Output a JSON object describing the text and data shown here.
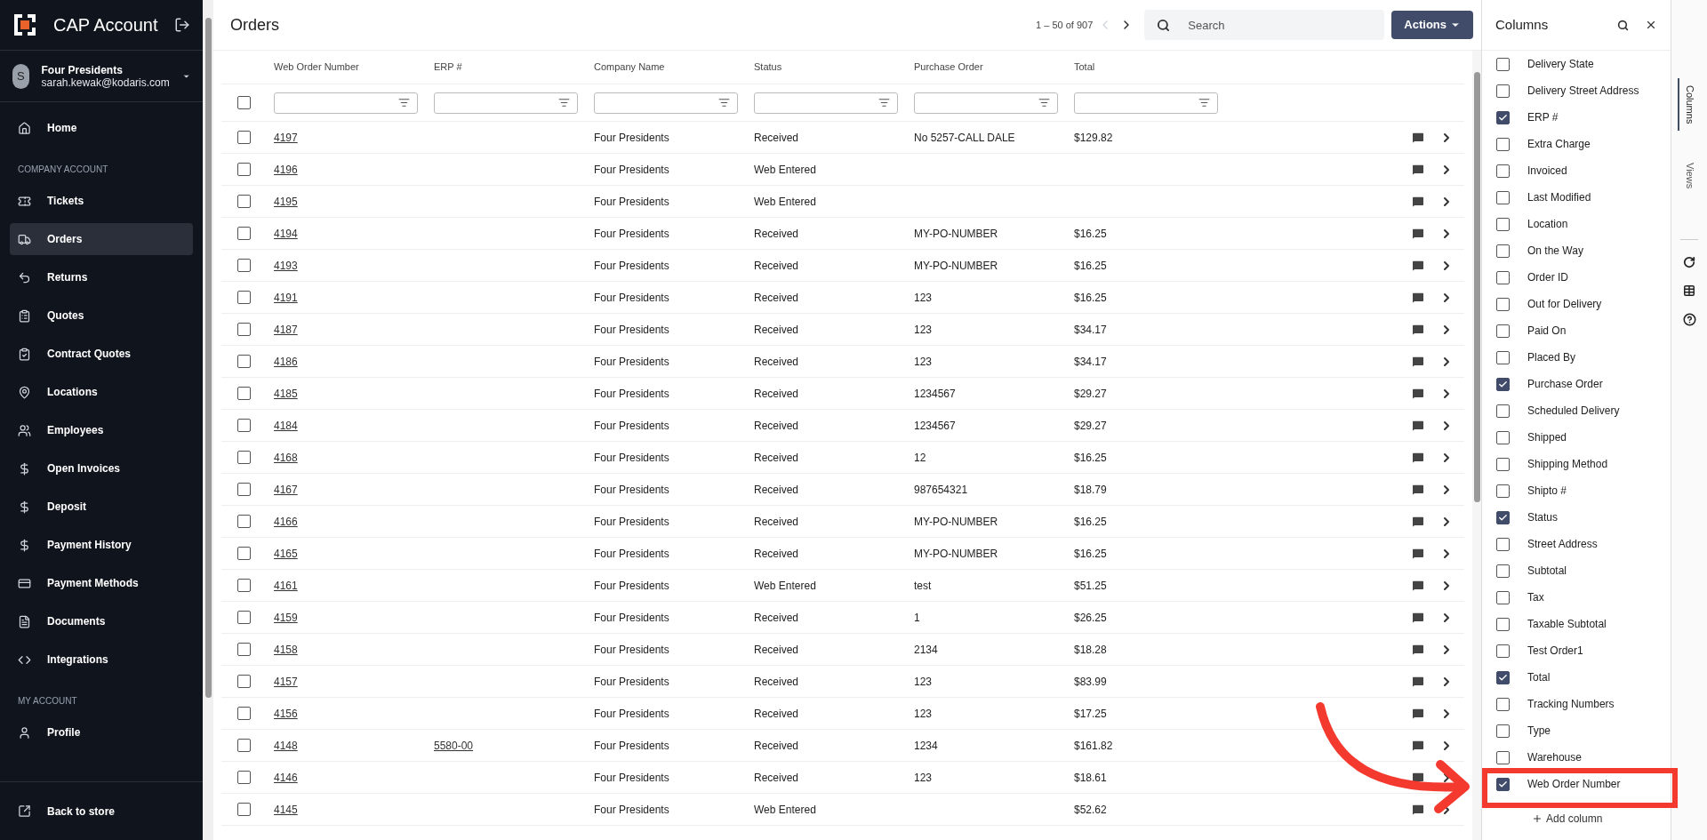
{
  "sidebar": {
    "app_title": "CAP Account",
    "user": {
      "initial": "S",
      "name": "Four Presidents",
      "email": "sarah.kewak@kodaris.com"
    },
    "sections": [
      {
        "items": [
          {
            "label": "Home",
            "selected": false
          }
        ]
      },
      {
        "heading": "COMPANY ACCOUNT",
        "items": [
          {
            "label": "Tickets",
            "selected": false
          },
          {
            "label": "Orders",
            "selected": true
          },
          {
            "label": "Returns",
            "selected": false
          },
          {
            "label": "Quotes",
            "selected": false
          },
          {
            "label": "Contract Quotes",
            "selected": false
          },
          {
            "label": "Locations",
            "selected": false
          },
          {
            "label": "Employees",
            "selected": false
          },
          {
            "label": "Open Invoices",
            "selected": false
          },
          {
            "label": "Deposit",
            "selected": false
          },
          {
            "label": "Payment History",
            "selected": false
          },
          {
            "label": "Payment Methods",
            "selected": false
          },
          {
            "label": "Documents",
            "selected": false
          },
          {
            "label": "Integrations",
            "selected": false
          }
        ]
      },
      {
        "heading": "MY ACCOUNT",
        "items": [
          {
            "label": "Profile",
            "selected": false
          }
        ]
      }
    ],
    "footer_item": "Back to store"
  },
  "header": {
    "title": "Orders",
    "pagination": "1 – 50 of 907",
    "search": {
      "placeholder": "Search"
    },
    "actions": "Actions"
  },
  "table": {
    "select_all_checked": false,
    "columns": [
      "Web Order Number",
      "ERP #",
      "Company Name",
      "Status",
      "Purchase Order",
      "Total"
    ],
    "rows": [
      {
        "checked": false,
        "cells": [
          "4197",
          "",
          "Four Presidents",
          "Received",
          "No 5257-CALL DALE",
          "$129.82"
        ]
      },
      {
        "checked": false,
        "cells": [
          "4196",
          "",
          "Four Presidents",
          "Web Entered",
          "",
          ""
        ]
      },
      {
        "checked": false,
        "cells": [
          "4195",
          "",
          "Four Presidents",
          "Web Entered",
          "",
          ""
        ]
      },
      {
        "checked": false,
        "cells": [
          "4194",
          "",
          "Four Presidents",
          "Received",
          "MY-PO-NUMBER",
          "$16.25"
        ]
      },
      {
        "checked": false,
        "cells": [
          "4193",
          "",
          "Four Presidents",
          "Received",
          "MY-PO-NUMBER",
          "$16.25"
        ]
      },
      {
        "checked": false,
        "cells": [
          "4191",
          "",
          "Four Presidents",
          "Received",
          "123",
          "$16.25"
        ]
      },
      {
        "checked": false,
        "cells": [
          "4187",
          "",
          "Four Presidents",
          "Received",
          "123",
          "$34.17"
        ]
      },
      {
        "checked": false,
        "cells": [
          "4186",
          "",
          "Four Presidents",
          "Received",
          "123",
          "$34.17"
        ]
      },
      {
        "checked": false,
        "cells": [
          "4185",
          "",
          "Four Presidents",
          "Received",
          "1234567",
          "$29.27"
        ]
      },
      {
        "checked": false,
        "cells": [
          "4184",
          "",
          "Four Presidents",
          "Received",
          "1234567",
          "$29.27"
        ]
      },
      {
        "checked": false,
        "cells": [
          "4168",
          "",
          "Four Presidents",
          "Received",
          "12",
          "$16.25"
        ]
      },
      {
        "checked": false,
        "cells": [
          "4167",
          "",
          "Four Presidents",
          "Received",
          "987654321",
          "$18.79"
        ]
      },
      {
        "checked": false,
        "cells": [
          "4166",
          "",
          "Four Presidents",
          "Received",
          "MY-PO-NUMBER",
          "$16.25"
        ]
      },
      {
        "checked": false,
        "cells": [
          "4165",
          "",
          "Four Presidents",
          "Received",
          "MY-PO-NUMBER",
          "$16.25"
        ]
      },
      {
        "checked": false,
        "cells": [
          "4161",
          "",
          "Four Presidents",
          "Web Entered",
          "test",
          "$51.25"
        ]
      },
      {
        "checked": false,
        "cells": [
          "4159",
          "",
          "Four Presidents",
          "Received",
          "1",
          "$26.25"
        ]
      },
      {
        "checked": false,
        "cells": [
          "4158",
          "",
          "Four Presidents",
          "Received",
          "2134",
          "$18.28"
        ]
      },
      {
        "checked": false,
        "cells": [
          "4157",
          "",
          "Four Presidents",
          "Received",
          "123",
          "$83.99"
        ]
      },
      {
        "checked": false,
        "cells": [
          "4156",
          "",
          "Four Presidents",
          "Received",
          "123",
          "$17.25"
        ]
      },
      {
        "checked": false,
        "cells": [
          "4148",
          "5580-00",
          "Four Presidents",
          "Received",
          "1234",
          "$161.82"
        ]
      },
      {
        "checked": false,
        "cells": [
          "4146",
          "",
          "Four Presidents",
          "Received",
          "123",
          "$18.61"
        ]
      },
      {
        "checked": false,
        "cells": [
          "4145",
          "",
          "Four Presidents",
          "Web Entered",
          "",
          "$52.62"
        ]
      }
    ]
  },
  "columns_panel": {
    "title": "Columns",
    "items": [
      {
        "label": "Delivery State",
        "checked": false
      },
      {
        "label": "Delivery Street Address",
        "checked": false
      },
      {
        "label": "ERP #",
        "checked": true
      },
      {
        "label": "Extra Charge",
        "checked": false
      },
      {
        "label": "Invoiced",
        "checked": false
      },
      {
        "label": "Last Modified",
        "checked": false
      },
      {
        "label": "Location",
        "checked": false
      },
      {
        "label": "On the Way",
        "checked": false
      },
      {
        "label": "Order ID",
        "checked": false
      },
      {
        "label": "Out for Delivery",
        "checked": false
      },
      {
        "label": "Paid On",
        "checked": false
      },
      {
        "label": "Placed By",
        "checked": false
      },
      {
        "label": "Purchase Order",
        "checked": true
      },
      {
        "label": "Scheduled Delivery",
        "checked": false
      },
      {
        "label": "Shipped",
        "checked": false
      },
      {
        "label": "Shipping Method",
        "checked": false
      },
      {
        "label": "Shipto #",
        "checked": false
      },
      {
        "label": "Status",
        "checked": true
      },
      {
        "label": "Street Address",
        "checked": false
      },
      {
        "label": "Subtotal",
        "checked": false
      },
      {
        "label": "Tax",
        "checked": false
      },
      {
        "label": "Taxable Subtotal",
        "checked": false
      },
      {
        "label": "Test Order1",
        "checked": false
      },
      {
        "label": "Total",
        "checked": true
      },
      {
        "label": "Tracking Numbers",
        "checked": false
      },
      {
        "label": "Type",
        "checked": false
      },
      {
        "label": "Warehouse",
        "checked": false
      },
      {
        "label": "Web Order Number",
        "checked": true
      }
    ],
    "add_column": "Add column"
  },
  "side_tabs": [
    {
      "label": "Columns",
      "selected": true
    },
    {
      "label": "Views",
      "selected": false
    }
  ]
}
